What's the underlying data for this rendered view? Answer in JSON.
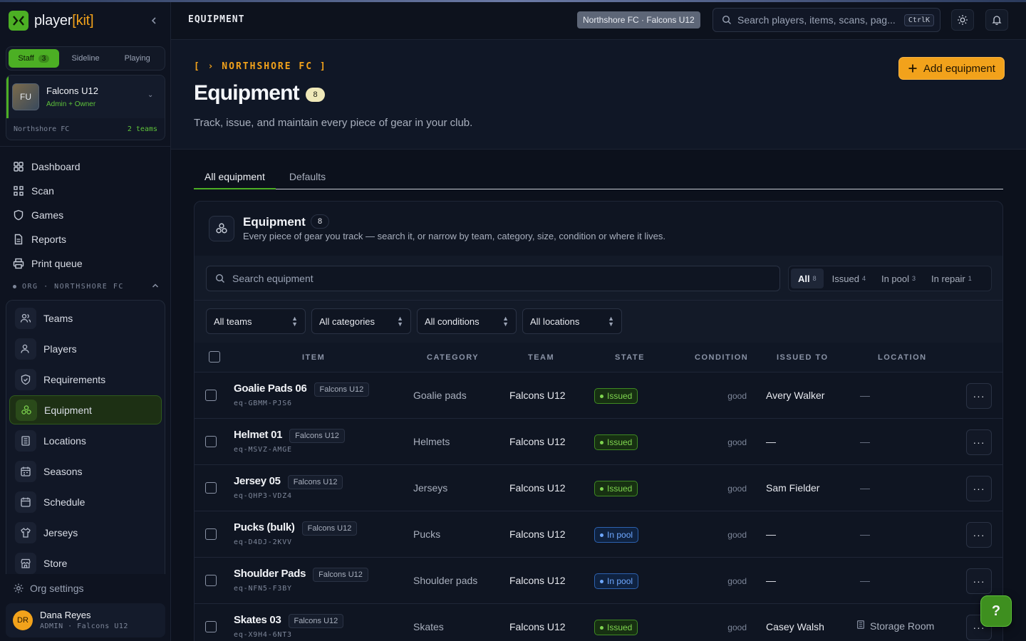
{
  "brand": {
    "name": "player",
    "bracket": "[kit]"
  },
  "sidebar": {
    "mode_tabs": [
      {
        "label": "Staff",
        "count": "3"
      },
      {
        "label": "Sideline"
      },
      {
        "label": "Playing"
      }
    ],
    "team_card": {
      "initials": "FU",
      "name": "Falcons U12",
      "role": "Admin + Owner",
      "org": "Northshore FC",
      "teams": "2 teams"
    },
    "nav": [
      {
        "label": "Dashboard",
        "icon": "dashboard-icon"
      },
      {
        "label": "Scan",
        "icon": "scan-icon"
      },
      {
        "label": "Games",
        "icon": "shield-icon"
      },
      {
        "label": "Reports",
        "icon": "report-icon"
      },
      {
        "label": "Print queue",
        "icon": "printer-icon"
      }
    ],
    "org_header": "ORG · NORTHSHORE FC",
    "org_items": [
      {
        "label": "Teams",
        "icon": "users-icon"
      },
      {
        "label": "Players",
        "icon": "user-icon"
      },
      {
        "label": "Requirements",
        "icon": "shield-check-icon"
      },
      {
        "label": "Equipment",
        "icon": "equipment-icon",
        "active": true
      },
      {
        "label": "Locations",
        "icon": "building-icon"
      },
      {
        "label": "Seasons",
        "icon": "calendar-icon"
      },
      {
        "label": "Schedule",
        "icon": "calendar-icon"
      },
      {
        "label": "Jerseys",
        "icon": "shirt-icon"
      },
      {
        "label": "Store",
        "icon": "store-icon"
      }
    ],
    "org_settings": "Org settings",
    "user": {
      "initials": "DR",
      "name": "Dana Reyes",
      "role": "ADMIN · Falcons U12"
    }
  },
  "topbar": {
    "title": "EQUIPMENT",
    "context": "Northshore FC · Falcons U12",
    "search_placeholder": "Search players, items, scans, pag...",
    "shortcut": "CtrlK"
  },
  "header": {
    "crumb": "[ › NORTHSHORE FC ]",
    "title": "Equipment",
    "count": "8",
    "description": "Track, issue, and maintain every piece of gear in your club.",
    "add_button": "Add equipment"
  },
  "tabs": [
    "All equipment",
    "Defaults"
  ],
  "panel": {
    "title": "Equipment",
    "count": "8",
    "subtitle": "Every piece of gear you track — search it, or narrow by team, category, size, condition or where it lives.",
    "search_placeholder": "Search equipment",
    "segments": [
      {
        "label": "All",
        "count": "8"
      },
      {
        "label": "Issued",
        "count": "4"
      },
      {
        "label": "In pool",
        "count": "3"
      },
      {
        "label": "In repair",
        "count": "1"
      }
    ],
    "filters": [
      "All teams",
      "All categories",
      "All conditions",
      "All locations"
    ],
    "columns": [
      "ITEM",
      "CATEGORY",
      "TEAM",
      "STATE",
      "CONDITION",
      "ISSUED TO",
      "LOCATION"
    ],
    "rows": [
      {
        "name": "Goalie Pads 06",
        "team_tag": "Falcons U12",
        "id": "eq-GBMM-PJS6",
        "category": "Goalie pads",
        "team": "Falcons U12",
        "state": "Issued",
        "condition": "good",
        "issued_to": "Avery Walker",
        "location": "—"
      },
      {
        "name": "Helmet 01",
        "team_tag": "Falcons U12",
        "id": "eq-MSVZ-AMGE",
        "category": "Helmets",
        "team": "Falcons U12",
        "state": "Issued",
        "condition": "good",
        "issued_to": "—",
        "location": "—"
      },
      {
        "name": "Jersey 05",
        "team_tag": "Falcons U12",
        "id": "eq-QHP3-VDZ4",
        "category": "Jerseys",
        "team": "Falcons U12",
        "state": "Issued",
        "condition": "good",
        "issued_to": "Sam Fielder",
        "location": "—"
      },
      {
        "name": "Pucks (bulk)",
        "team_tag": "Falcons U12",
        "id": "eq-D4DJ-2KVV",
        "category": "Pucks",
        "team": "Falcons U12",
        "state": "In pool",
        "condition": "good",
        "issued_to": "—",
        "location": "—"
      },
      {
        "name": "Shoulder Pads",
        "team_tag": "Falcons U12",
        "id": "eq-NFN5-F3BY",
        "category": "Shoulder pads",
        "team": "Falcons U12",
        "state": "In pool",
        "condition": "good",
        "issued_to": "—",
        "location": "—"
      },
      {
        "name": "Skates 03",
        "team_tag": "Falcons U12",
        "id": "eq-X9H4-6NT3",
        "category": "Skates",
        "team": "Falcons U12",
        "state": "Issued",
        "condition": "good",
        "issued_to": "Casey Walsh",
        "location": "Storage Room"
      }
    ]
  },
  "help_label": "?"
}
